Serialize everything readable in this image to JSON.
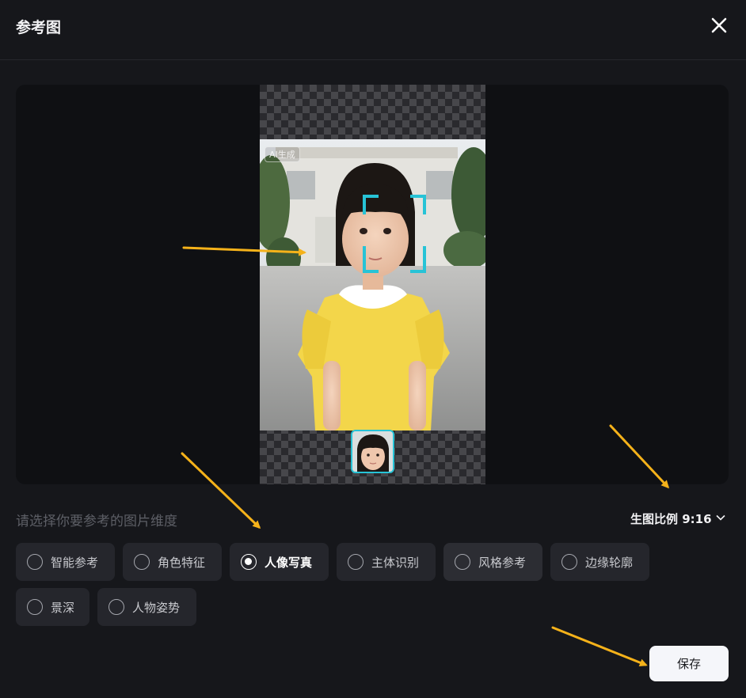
{
  "header": {
    "title": "参考图",
    "close_icon": "close-icon"
  },
  "preview": {
    "ai_badge": "AI生成",
    "face_frame_color": "#27c3d6",
    "photo_subject": "girl in yellow dress with white collar"
  },
  "dimension": {
    "prompt": "请选择你要参考的图片维度",
    "ratio_label": "生图比例 9:16",
    "ratio_icon": "chevron-down-icon"
  },
  "options": [
    {
      "label": "智能参考",
      "selected": false
    },
    {
      "label": "角色特征",
      "selected": false
    },
    {
      "label": "人像写真",
      "selected": true
    },
    {
      "label": "主体识别",
      "selected": false
    },
    {
      "label": "风格参考",
      "selected": false
    },
    {
      "label": "边缘轮廓",
      "selected": false
    },
    {
      "label": "景深",
      "selected": false
    },
    {
      "label": "人物姿势",
      "selected": false
    }
  ],
  "footer": {
    "save_label": "保存"
  },
  "colors": {
    "background": "#16171b",
    "accent": "#27c3d6",
    "annotation_arrow": "#f5b21a"
  }
}
